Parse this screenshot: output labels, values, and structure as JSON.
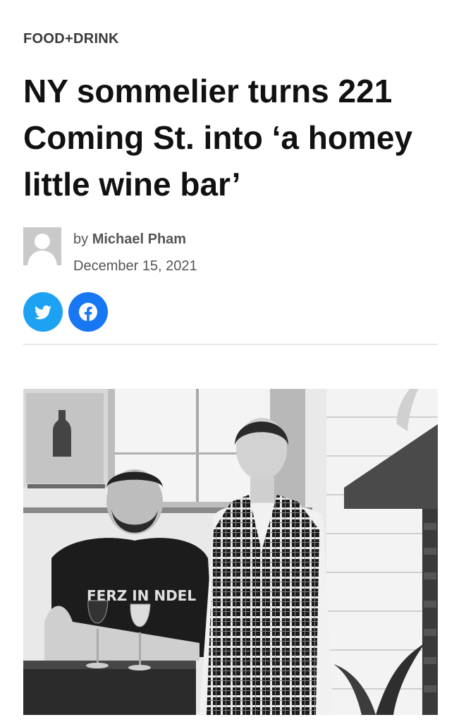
{
  "article": {
    "category": "FOOD+DRINK",
    "headline": "NY sommelier turns 221 Coming St. into ‘a homey little wine bar’",
    "byline_prefix": "by",
    "author": "Michael Pham",
    "date": "December 15, 2021"
  },
  "share": {
    "twitter_icon": "twitter-bird-icon",
    "facebook_icon": "facebook-f-icon"
  },
  "photo": {
    "tshirt_text": "FERZ IN NDEL",
    "style": "black-and-white"
  },
  "colors": {
    "twitter": "#1da1f2",
    "facebook": "#1877f2",
    "category": "#3a3a3a",
    "meta_text": "#555555",
    "divider": "#e6e6e6"
  }
}
